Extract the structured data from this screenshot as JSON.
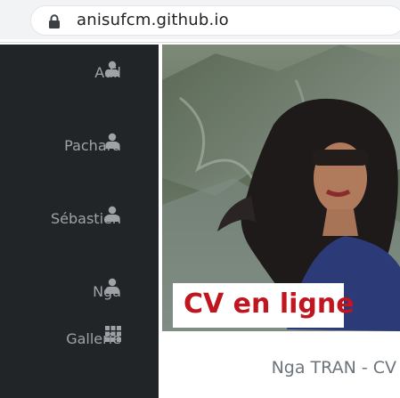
{
  "browser": {
    "url": "anisufcm.github.io"
  },
  "sidebar": {
    "items": [
      {
        "label": "Adil",
        "icon": "user-icon"
      },
      {
        "label": "Pachara",
        "icon": "user-icon"
      },
      {
        "label": "Sébastien",
        "icon": "user-icon"
      },
      {
        "label": "Nga",
        "icon": "user-icon"
      },
      {
        "label": "Gallerie",
        "icon": "grid-icon"
      }
    ]
  },
  "hero": {
    "banner_text": "CV en ligne"
  },
  "main": {
    "title": "Nga TRAN - CV"
  },
  "colors": {
    "sidebar_bg": "#222528",
    "sidebar_text": "#9ea3a8",
    "banner_text": "#c0161f",
    "title_text": "#6c757d"
  }
}
